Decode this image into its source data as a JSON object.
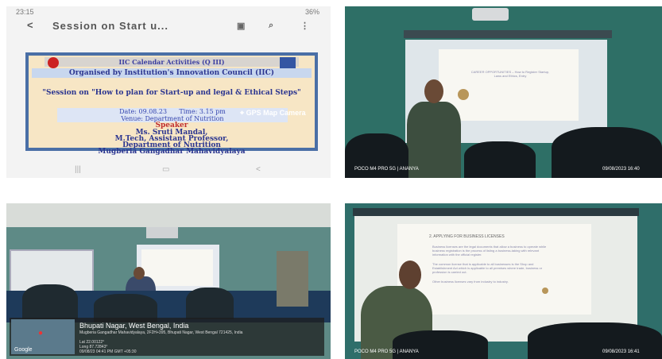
{
  "panel1": {
    "status_time": "23:15",
    "status_right": "36%",
    "back_arrow": "<",
    "title": "Session on Start u...",
    "poster": {
      "header": "IIC Calendar Activities (Q III)",
      "organiser": "Organised by Institution's Innovation Council (IIC)",
      "session": "\"Session on \"How to plan for Start-up and legal & Ethical Steps\"",
      "date": "Date: 09.08.23",
      "time": "Time: 3.15 pm",
      "venue": "Venue: Department of Nutrition",
      "speaker_label": "Speaker",
      "speaker_name": "Ms. Sruti Mandal,",
      "speaker_title": "M.Tech, Assistant Professor,",
      "speaker_dept": "Department of Nutrition",
      "college": "Mugberia Gangadhar Mahavidyalaya"
    },
    "nav_icons": [
      "menu-icon",
      "home-icon",
      "back-icon"
    ]
  },
  "panel2": {
    "slide_text": "CAREER OPPORTUNITIES – How to Register Startup, Laws and Ethics, Entry",
    "watermark": "POCO M4 PRO 5G | ANANYA",
    "timestamp": "09/08/2023  16:40"
  },
  "panel3": {
    "gps_badge": "GPS Map Camera",
    "place": "Bhupati Nagar, West Bengal, India",
    "address": "Mugberia Gangadhar Mahavidyalaya, 2F2H+395, Bhupati Nagar, West Bengal 721425, India",
    "lat": "Lat 22.00122°",
    "long": "Long 87.72843°",
    "datetime": "09/08/23 04:41 PM GMT +05:30",
    "google": "Google"
  },
  "panel4": {
    "slide_heading": "2. APPLYING FOR BUSINESS LICENSES",
    "slide_b1": "Business licenses are the legal documents that allow a business to operate while business registration is the process of listing a business-taking with relevant information with the official register.",
    "slide_b2": "The common license that is applicable to all businesses is the Shop and Establishment Act which is applicable to all premises where trade, business or profession is carried out.",
    "slide_b3": "Other business licenses vary from industry to industry.",
    "watermark": "POCO M4 PRO 5G | ANANYA",
    "timestamp": "09/08/2023  16:41"
  }
}
